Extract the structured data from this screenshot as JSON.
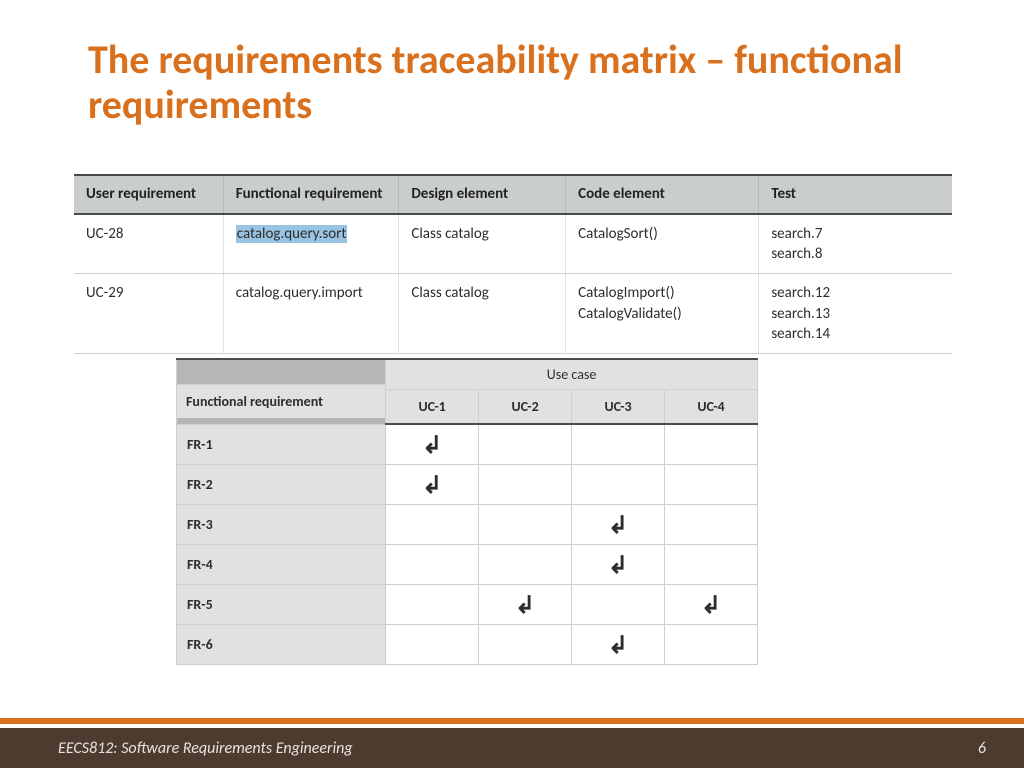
{
  "title": "The requirements traceability matrix – functional requirements",
  "table1": {
    "headers": [
      "User requirement",
      "Functional requirement",
      "Design element",
      "Code element",
      "Test"
    ],
    "rows": [
      {
        "ur": "UC-28",
        "fr": "catalog.query.sort",
        "fr_highlight": true,
        "de": "Class catalog",
        "ce": "CatalogSort()",
        "test": "search.7\nsearch.8"
      },
      {
        "ur": "UC-29",
        "fr": "catalog.query.import",
        "fr_highlight": false,
        "de": "Class catalog",
        "ce": "CatalogImport()\nCatalogValidate()",
        "test": "search.12\nsearch.13\nsearch.14"
      }
    ]
  },
  "table2": {
    "group_label": "Use case",
    "fr_header": "Functional requirement",
    "uc_headers": [
      "UC-1",
      "UC-2",
      "UC-3",
      "UC-4"
    ],
    "rows": [
      {
        "fr": "FR-1",
        "marks": [
          true,
          false,
          false,
          false
        ]
      },
      {
        "fr": "FR-2",
        "marks": [
          true,
          false,
          false,
          false
        ]
      },
      {
        "fr": "FR-3",
        "marks": [
          false,
          false,
          true,
          false
        ]
      },
      {
        "fr": "FR-4",
        "marks": [
          false,
          false,
          true,
          false
        ]
      },
      {
        "fr": "FR-5",
        "marks": [
          false,
          true,
          false,
          true
        ]
      },
      {
        "fr": "FR-6",
        "marks": [
          false,
          false,
          true,
          false
        ]
      }
    ]
  },
  "footer": {
    "course": "EECS812: Software Requirements Engineering",
    "page": "6"
  },
  "check_glyph": "↲"
}
